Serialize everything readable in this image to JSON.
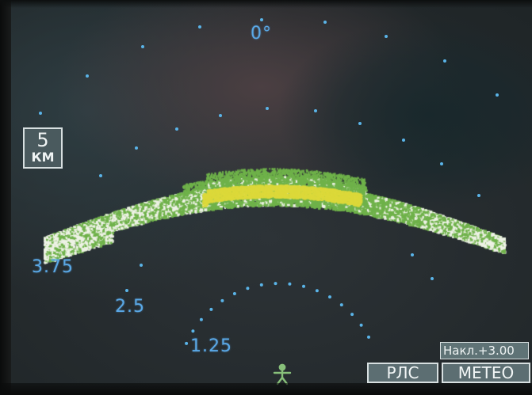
{
  "radar": {
    "heading_label": "0°",
    "range_rings": [
      "3.75",
      "2.5",
      "1.25"
    ],
    "range_scale": {
      "value": "5",
      "unit": "КМ"
    },
    "tilt": "Накл.+3.00",
    "modes": [
      {
        "label": "РЛС",
        "icon": "radar-mode"
      },
      {
        "label": "METEO",
        "icon": "weather-mode"
      }
    ],
    "colors": {
      "scale_text": "#5aa8e6",
      "dots": "#5ab4e8",
      "echo_white": "#eef2e6",
      "echo_green": "#6fb24a",
      "echo_yellow": "#dcd93a",
      "aircraft": "#88c07a"
    },
    "aircraft_icon": "aircraft-symbol-icon"
  }
}
